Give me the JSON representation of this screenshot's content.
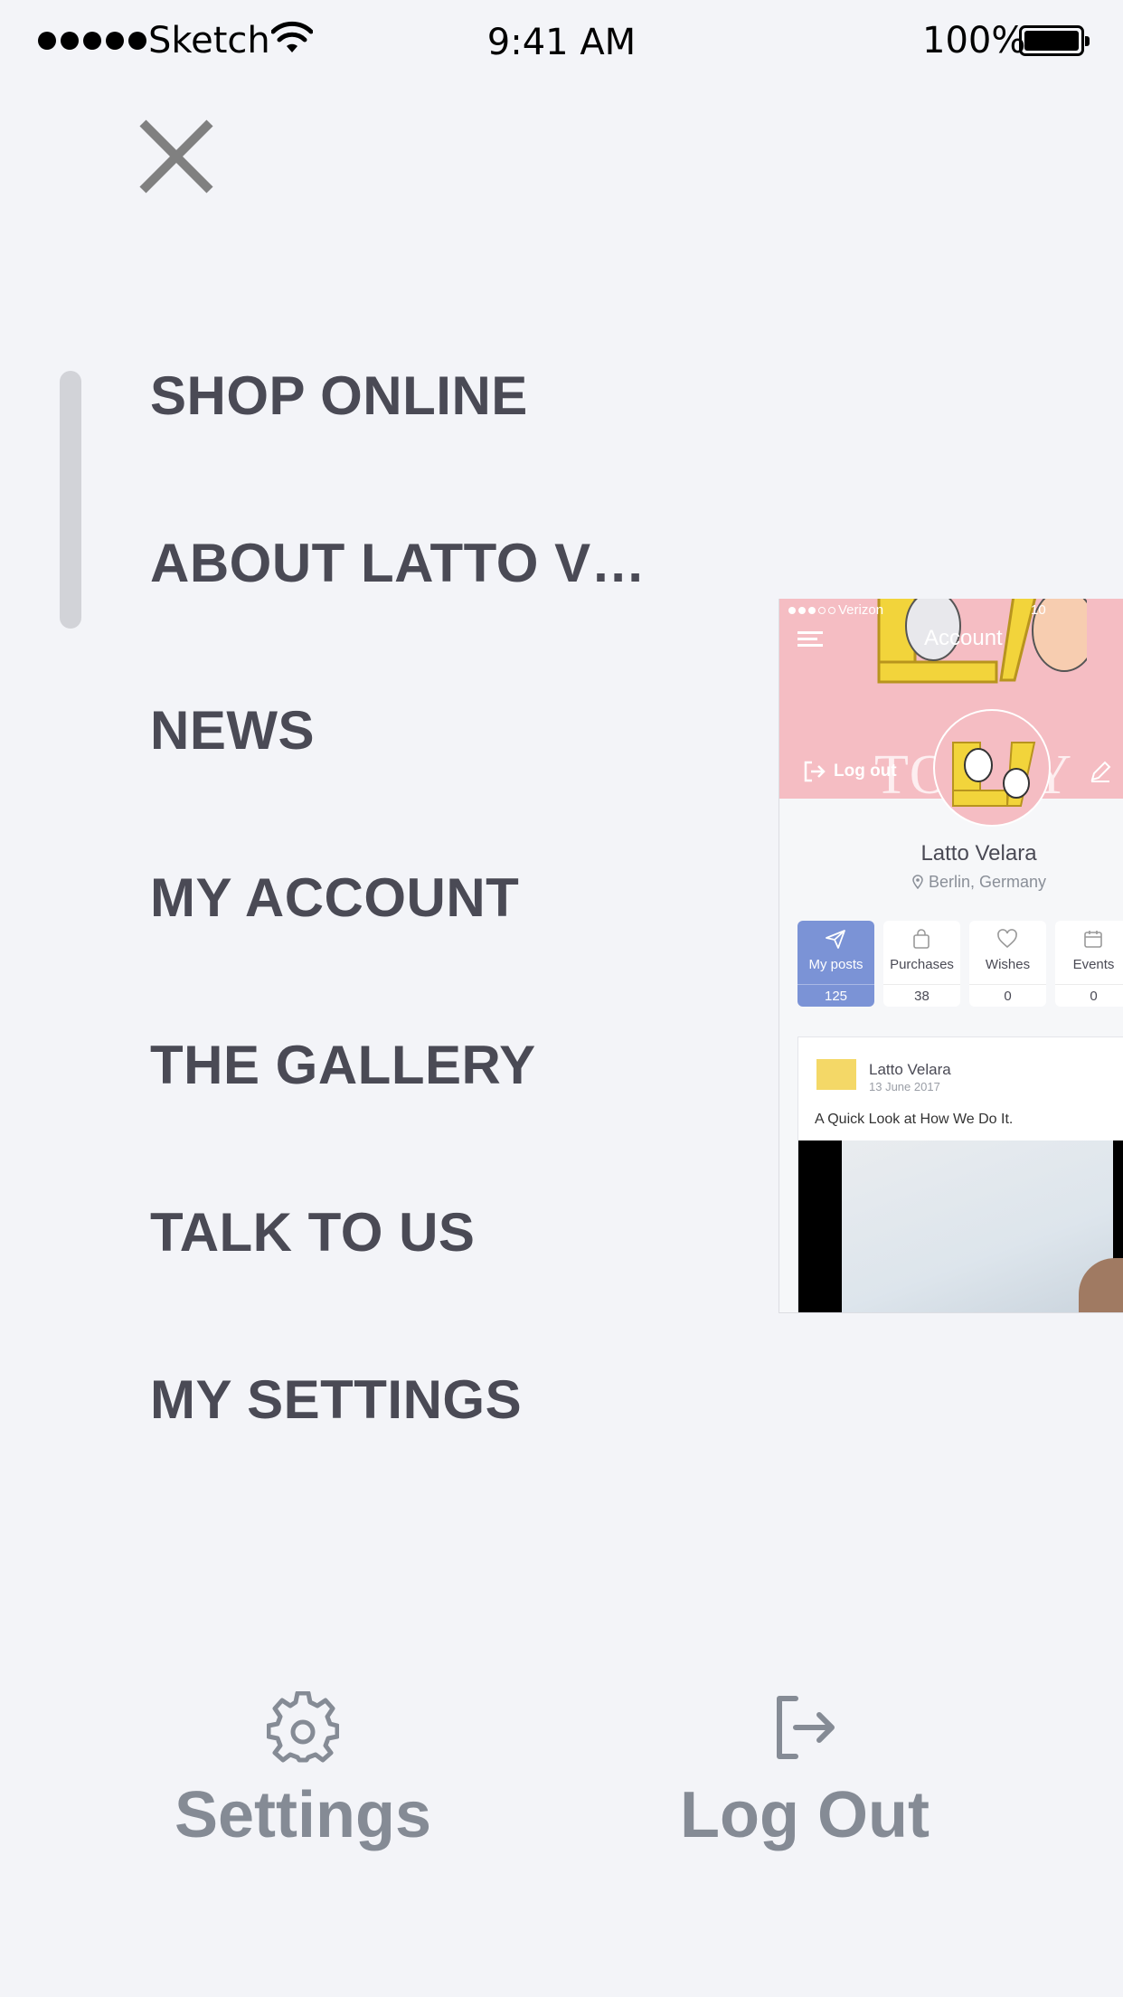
{
  "status_bar": {
    "carrier": "Sketch",
    "time": "9:41 AM",
    "battery": "100%"
  },
  "menu": {
    "items": [
      {
        "label": "SHOP ONLINE"
      },
      {
        "label": "ABOUT LATTO V…"
      },
      {
        "label": "NEWS"
      },
      {
        "label": "MY ACCOUNT"
      },
      {
        "label": "THE GALLERY"
      },
      {
        "label": "TALK TO US"
      },
      {
        "label": "MY SETTINGS"
      }
    ]
  },
  "preview": {
    "carrier": "Verizon",
    "battery_partial": "10",
    "title": "Account",
    "logout_label": "Log out",
    "banner_text": "TODAY",
    "profile_name": "Latto Velara",
    "location": "Berlin, Germany",
    "stats": [
      {
        "label": "My posts",
        "value": "125",
        "icon": "send-icon"
      },
      {
        "label": "Purchases",
        "value": "38",
        "icon": "bag-icon"
      },
      {
        "label": "Wishes",
        "value": "0",
        "icon": "heart-icon"
      },
      {
        "label": "Events",
        "value": "0",
        "icon": "calendar-icon"
      }
    ],
    "post": {
      "author": "Latto Velara",
      "date": "13 June 2017",
      "text": "A Quick Look at How We Do It."
    },
    "accent_color": "#7b93d6"
  },
  "footer": {
    "settings_label": "Settings",
    "logout_label": "Log Out"
  },
  "colors": {
    "background": "#f3f4f8",
    "menu_text": "#4a4a55",
    "footer_text": "#858b95"
  }
}
